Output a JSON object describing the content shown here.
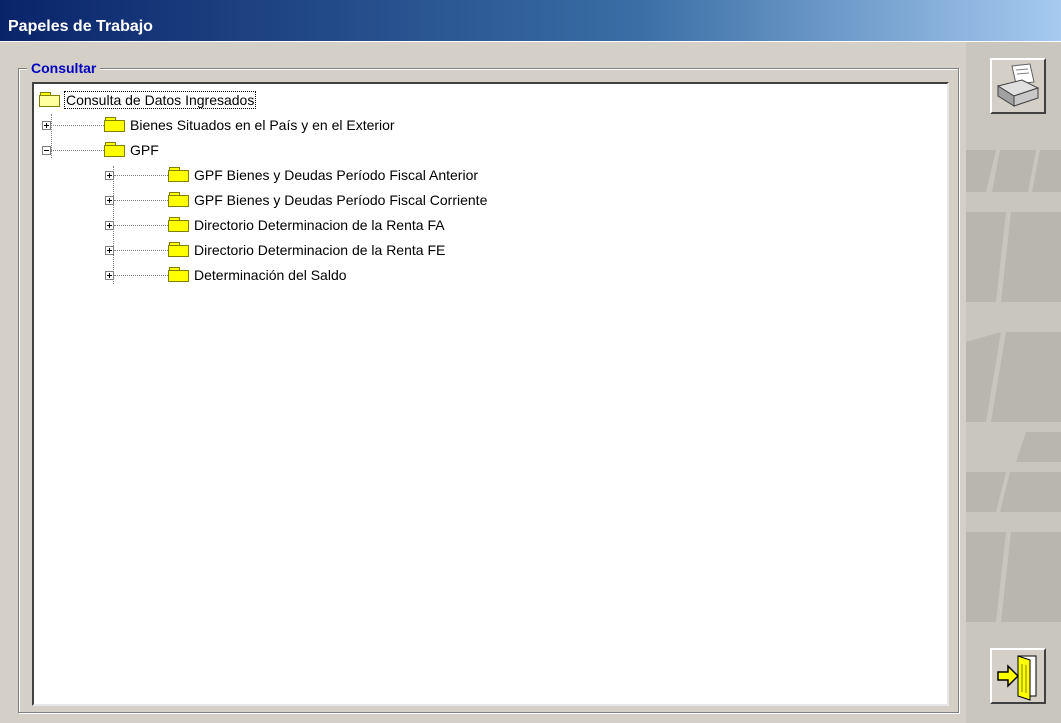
{
  "window": {
    "title": "Papeles de Trabajo"
  },
  "group": {
    "label": "Consultar"
  },
  "tree": {
    "root": {
      "label": "Consulta de Datos Ingresados",
      "expanded": true,
      "selected": true
    },
    "items": [
      {
        "label": "Bienes Situados en el País y en el Exterior",
        "expanded": false
      },
      {
        "label": "GPF",
        "expanded": true
      },
      {
        "label": "GPF Bienes y Deudas Período Fiscal Anterior",
        "expanded": false
      },
      {
        "label": "GPF Bienes y Deudas Período Fiscal Corriente",
        "expanded": false
      },
      {
        "label": "Directorio Determinacion de la Renta FA",
        "expanded": false
      },
      {
        "label": "Directorio Determinacion de la Renta FE",
        "expanded": false
      },
      {
        "label": "Determinación del Saldo",
        "expanded": false
      }
    ]
  },
  "buttons": {
    "print": {
      "icon": "printer-icon"
    },
    "exit": {
      "icon": "exit-door-icon"
    }
  },
  "colors": {
    "title_bar_start": "#0a246a",
    "title_bar_end": "#a6caf0",
    "legend_text": "#0000c0",
    "folder": "#ffff00",
    "window_bg": "#d4d0c8"
  }
}
